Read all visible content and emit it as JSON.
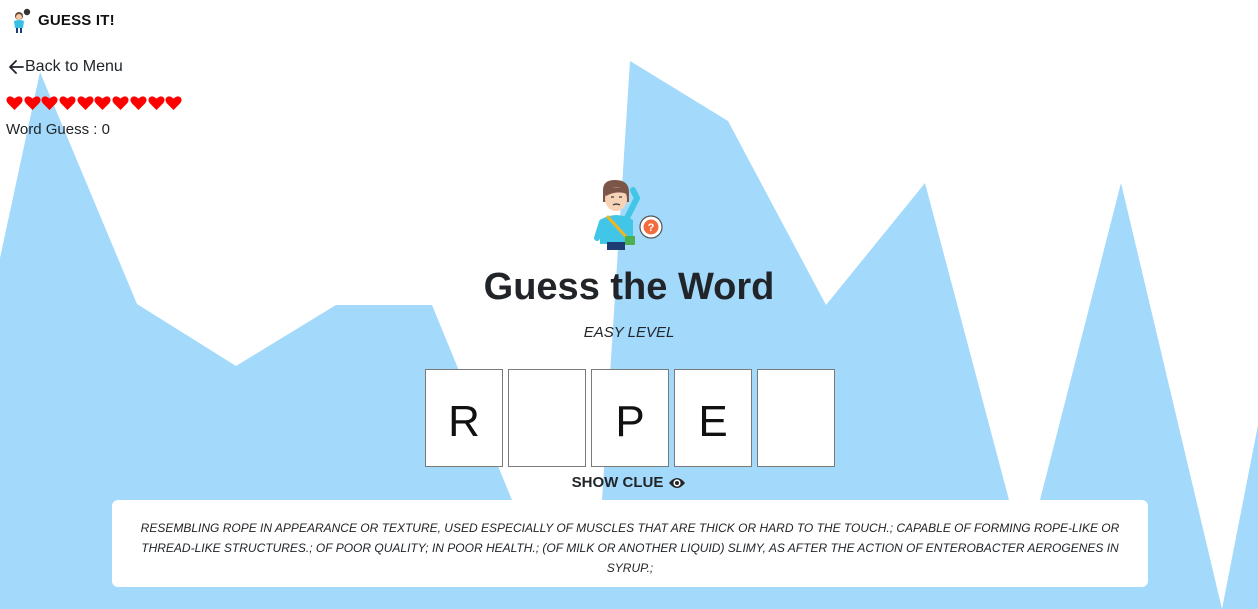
{
  "app": {
    "brand": "GUESS IT!",
    "back_link": "Back to Menu"
  },
  "colors": {
    "background": "#ffffff",
    "mountain": "#a3d9fb",
    "heart": "#ff0000",
    "tile_border": "#7a7a7a"
  },
  "stats": {
    "lives": 10,
    "word_guess_label": "Word Guess : 0"
  },
  "game": {
    "title": "Guess the Word",
    "level": "EASY LEVEL",
    "tiles": [
      {
        "letter": "R"
      },
      {
        "letter": ""
      },
      {
        "letter": "P"
      },
      {
        "letter": "E"
      },
      {
        "letter": ""
      }
    ],
    "show_clue_label": "SHOW CLUE",
    "clue": "RESEMBLING ROPE IN APPEARANCE OR TEXTURE, USED ESPECIALLY OF MUSCLES THAT ARE THICK OR HARD TO THE TOUCH.; CAPABLE OF FORMING ROPE-LIKE OR THREAD-LIKE STRUCTURES.; OF POOR QUALITY; IN POOR HEALTH.; (OF MILK OR ANOTHER LIQUID) SLIMY, AS AFTER THE ACTION OF ENTEROBACTER AEROGENES IN SYRUP.;"
  },
  "icons": {
    "brand": "thinking-person-icon",
    "back": "arrow-left-icon",
    "heart": "heart-icon",
    "mascot": "confused-person-icon",
    "show_clue": "eye-icon"
  }
}
